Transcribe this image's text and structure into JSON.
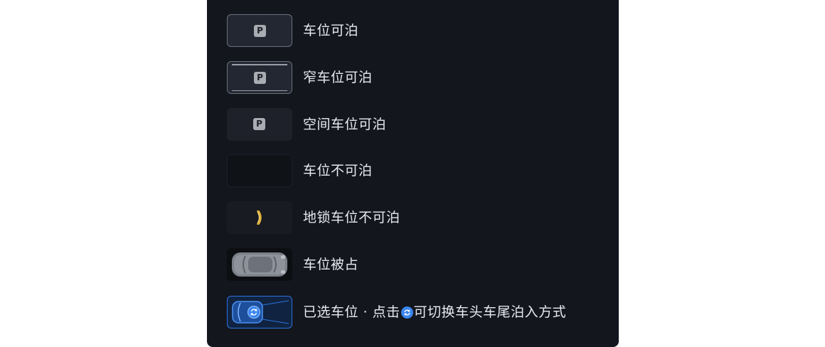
{
  "legend": {
    "rows": [
      {
        "label": "车位可泊"
      },
      {
        "label": "窄车位可泊"
      },
      {
        "label": "空间车位可泊"
      },
      {
        "label": "车位不可泊"
      },
      {
        "label": "地锁车位不可泊"
      },
      {
        "label": "车位被占"
      },
      {
        "label_before": "已选车位 · 点击",
        "label_after": "可切换车头车尾泊入方式"
      }
    ],
    "p_symbol": "P"
  },
  "icons": {
    "parking": "parking-p-icon",
    "lock": "ground-lock-icon",
    "car": "car-top-view-icon",
    "switch": "switch-direction-icon"
  },
  "colors": {
    "panel_bg": "#13161d",
    "text": "#e8eaee",
    "accent_blue": "#2b74e0",
    "lock_gold": "#e2b23a"
  }
}
